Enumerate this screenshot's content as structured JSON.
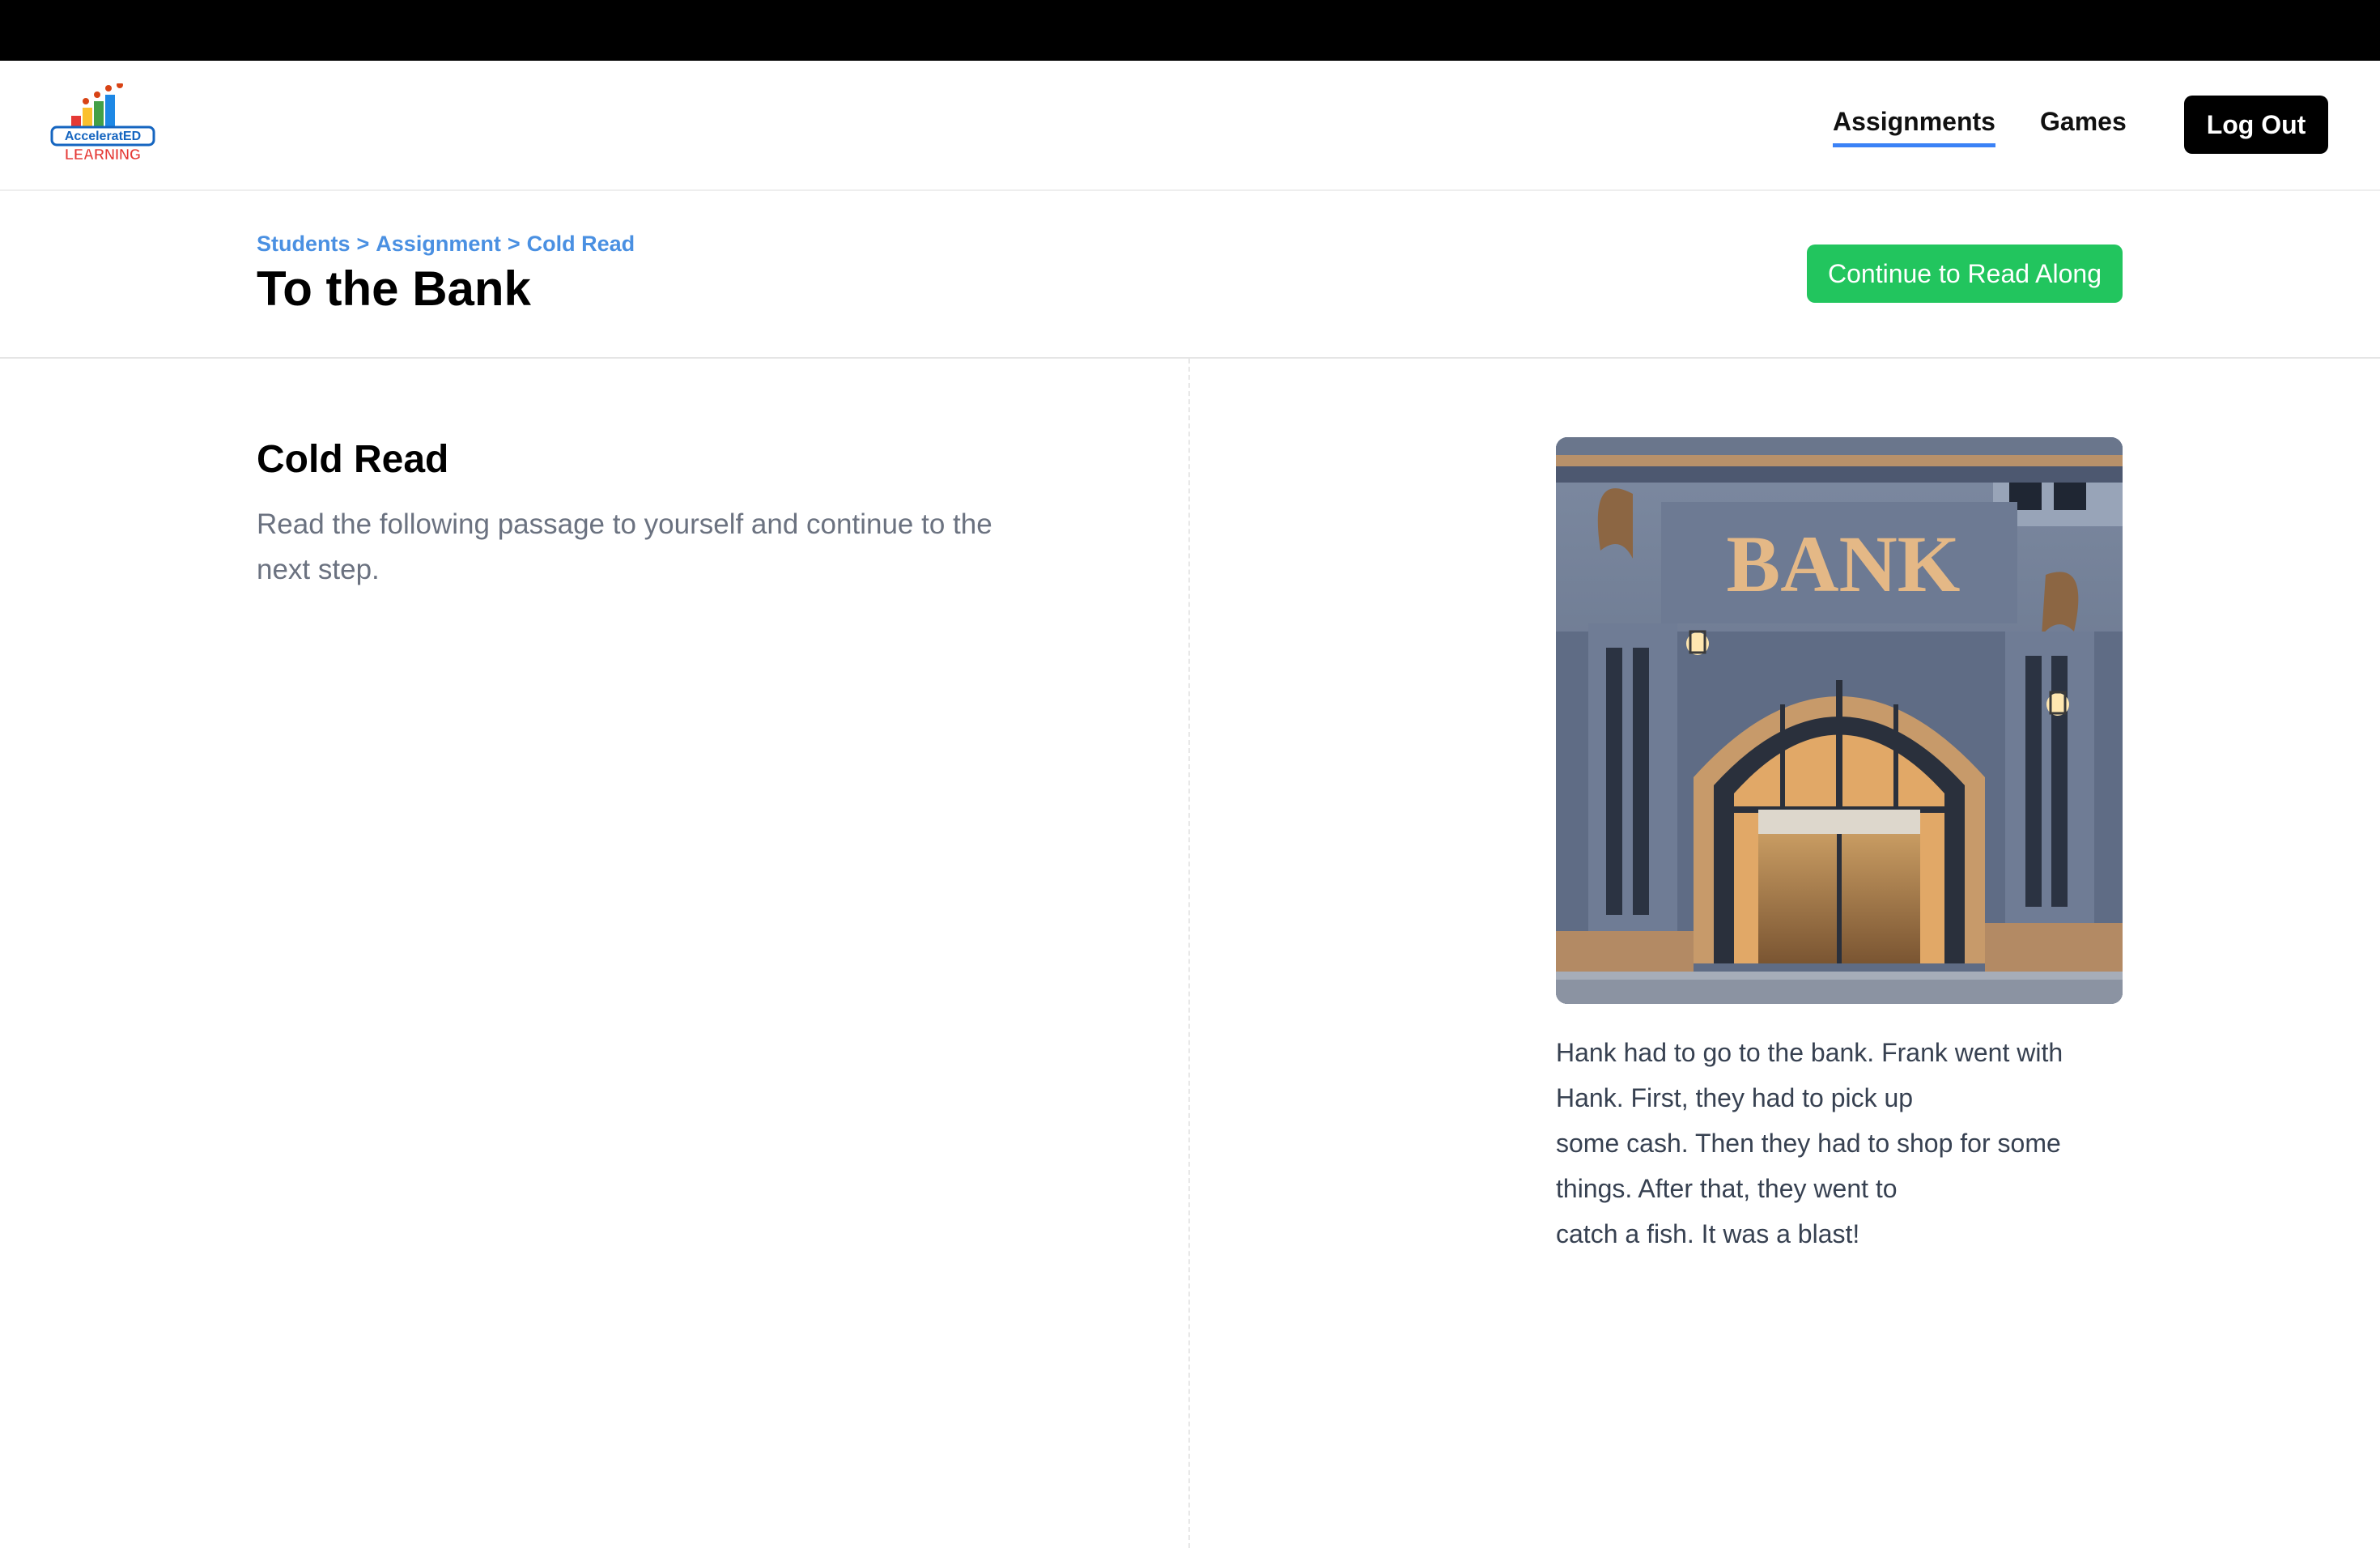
{
  "nav": {
    "logo_alt": "AccelerateED Learning",
    "links": [
      {
        "label": "Assignments",
        "active": true
      },
      {
        "label": "Games",
        "active": false
      }
    ],
    "logout_label": "Log Out"
  },
  "header": {
    "breadcrumb": [
      "Students",
      "Assignment",
      "Cold Read"
    ],
    "breadcrumb_separator": ">",
    "title": "To the Bank",
    "continue_label": "Continue to Read Along"
  },
  "section": {
    "title": "Cold Read",
    "description": "Read the following passage to yourself and continue to the next step."
  },
  "image": {
    "sign_text": "BANK"
  },
  "passage": {
    "lines": [
      "Hank had to go to the bank. Frank went with",
      "Hank. First, they had to pick up",
      "some cash. Then they had to shop for some",
      "things. After that, they went to",
      "catch a fish. It was a blast!"
    ]
  },
  "colors": {
    "accent_blue": "#3b82f6",
    "breadcrumb_blue": "#4a90e2",
    "continue_green": "#22c55e",
    "topbar": "#000000"
  }
}
